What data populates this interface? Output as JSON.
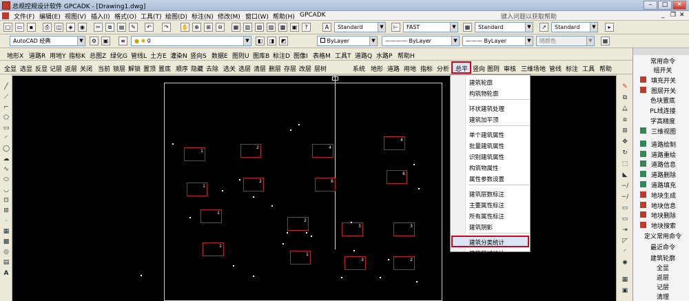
{
  "window": {
    "title": "总规控规设计软件 GPCADK - [Drawing1.dwg]",
    "help_placeholder": "键入问题以获取帮助"
  },
  "menubar": {
    "items": [
      "文件(F)",
      "编辑(E)",
      "视图(V)",
      "插入(I)",
      "格式(O)",
      "工具(T)",
      "绘图(D)",
      "标注(N)",
      "修改(M)",
      "窗口(W)",
      "帮助(H)",
      "GPCADK"
    ]
  },
  "toolbar2": {
    "text_style": "Standard",
    "dim_style": "FAST",
    "table_style": "Standard",
    "multileader_style": "Standard"
  },
  "toolbar3": {
    "workspace": "AutoCAD 经典",
    "layer": "0",
    "color": "ByLayer",
    "linetype": "ByLayer",
    "lineweight": "ByLayer",
    "plotstyle": "随颜色"
  },
  "gpc_menu": {
    "items": [
      "地形X",
      "道路R",
      "用地Y",
      "指标K",
      "总图Z",
      "绿化G",
      "管线L",
      "土方E",
      "灌染N",
      "竖向S",
      "数据E",
      "图则U",
      "图库B",
      "标注D",
      "图像I",
      "表格M",
      "工具T",
      "道路Q",
      "水路P",
      "帮助H"
    ]
  },
  "toolbar4": {
    "left_items": [
      "全显",
      "选显",
      "反显",
      "记层",
      "返层",
      "关闭",
      "当前",
      "锁层",
      "解锁",
      "置顶",
      "置底",
      "顺序",
      "隐藏",
      "去除",
      "选关",
      "选层",
      "清层",
      "删层",
      "存层",
      "改层",
      "层树"
    ],
    "right_items": [
      "系统",
      "地形",
      "道路",
      "用地",
      "指标",
      "总平",
      "竖向",
      "图则",
      "审核",
      "三维场地",
      "管线",
      "标注",
      "工具",
      "帮助"
    ]
  },
  "dropdown": {
    "groups": [
      [
        "建筑轮廓",
        "构筑物轮廓"
      ],
      [
        "环状建筑处理",
        "建筑加平顶"
      ],
      [
        "单个建筑属性",
        "批量建筑属性",
        "识别建筑属性",
        "构筑物属性",
        "属性参数设置"
      ],
      [
        "建筑层数标注",
        "主要属性标注",
        "所有属性标注",
        "建筑阴影"
      ],
      [
        "建筑分类统计",
        "建筑区域统计"
      ]
    ],
    "highlighted": "建筑分类统计"
  },
  "right_panel": {
    "header": "常用命令",
    "common": [
      {
        "label": "组开关",
        "icon": null
      },
      {
        "label": "填充开关",
        "icon": "#c0392b"
      },
      {
        "label": "图层开关",
        "icon": "#c0392b"
      },
      {
        "label": "色块置底",
        "icon": null
      },
      {
        "label": "PL线连接",
        "icon": null
      },
      {
        "label": "字高精度",
        "icon": null
      },
      {
        "label": "三维视图",
        "icon": "#2e8b57"
      },
      {
        "label": "道路绘制",
        "icon": "#2e8b57"
      },
      {
        "label": "道路重绘",
        "icon": "#2e8b57"
      },
      {
        "label": "道路信息",
        "icon": "#2e8b57"
      },
      {
        "label": "道路删除",
        "icon": "#2e8b57"
      },
      {
        "label": "道路填充",
        "icon": "#2e8b57"
      },
      {
        "label": "地块生成",
        "icon": "#c0392b"
      },
      {
        "label": "地块信息",
        "icon": "#c0392b"
      },
      {
        "label": "地块删除",
        "icon": "#c0392b"
      },
      {
        "label": "地块搜索",
        "icon": "#c0392b"
      },
      {
        "label": "定义常用命令",
        "icon": null
      }
    ],
    "recent_header": "最近命令",
    "recent": [
      "建筑轮廓",
      "全显",
      "返层",
      "记层",
      "清理"
    ]
  },
  "canvas": {
    "buildings": [
      {
        "label": "1"
      },
      {
        "label": "2"
      },
      {
        "label": "4"
      },
      {
        "label": "4"
      },
      {
        "label": "1"
      },
      {
        "label": "2"
      },
      {
        "label": "6"
      },
      {
        "label": "6"
      },
      {
        "label": "1"
      },
      {
        "label": "2"
      },
      {
        "label": "3"
      },
      {
        "label": "3"
      },
      {
        "label": "1"
      },
      {
        "label": "1"
      },
      {
        "label": "3"
      },
      {
        "label": "2"
      }
    ]
  }
}
